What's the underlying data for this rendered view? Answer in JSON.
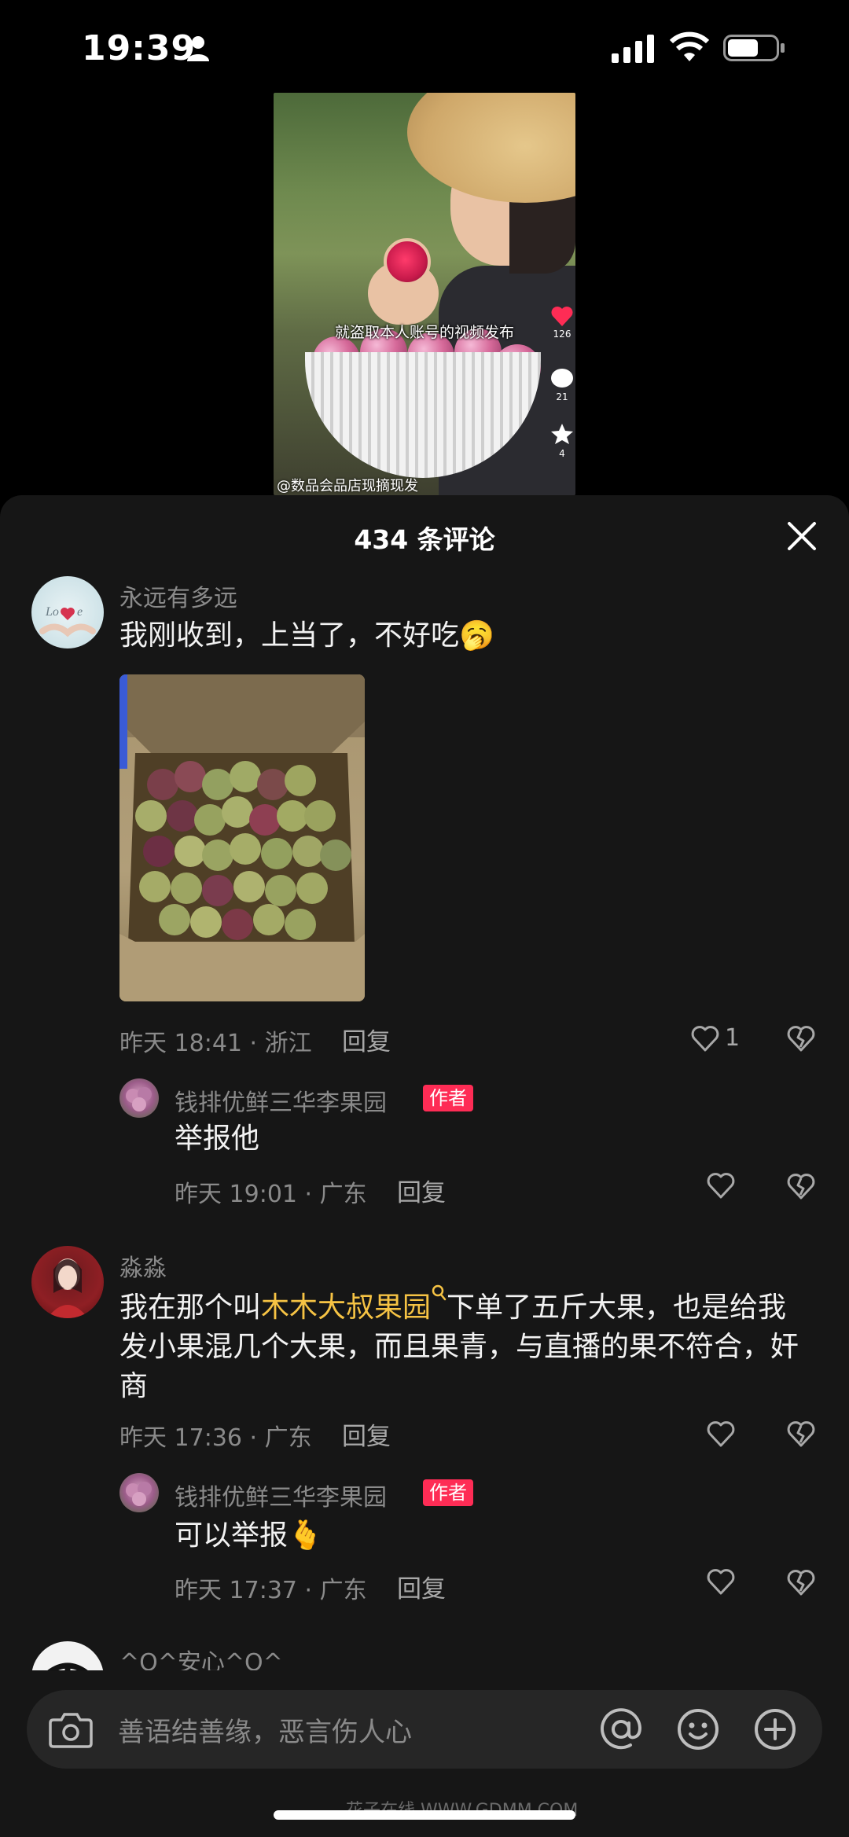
{
  "status_bar": {
    "time": "19:39"
  },
  "video": {
    "caption": "就盗取本人账号的视频发布",
    "side_counts": [
      "126",
      "21",
      "4"
    ],
    "bottom_text": "@数品会品店现摘现发"
  },
  "comments_panel": {
    "title": "434 条评论",
    "comments": [
      {
        "username": "永远有多远",
        "text": "我刚收到，上当了，不好吃🥱",
        "meta": "昨天 18:41 · 浙江",
        "reply_label": "回复",
        "like_count": "1"
      },
      {
        "username": "钱排优鲜三华李果园",
        "badge": "作者",
        "text": "举报他",
        "meta": "昨天 19:01 · 广东",
        "reply_label": "回复"
      },
      {
        "username": "淼淼",
        "text_before": "我在那个叫",
        "text_link": "木木大叔果园",
        "text_after": "下单了五斤大果，也是给我发小果混几个大果，而且果青，与直播的果不符合，奸商",
        "meta": "昨天 17:36 · 广东",
        "reply_label": "回复"
      },
      {
        "username": "钱排优鲜三华李果园",
        "badge": "作者",
        "text": "可以举报🫰",
        "meta": "昨天 17:37 · 广东",
        "reply_label": "回复"
      },
      {
        "username": "^O^安心^O^"
      }
    ]
  },
  "input_bar": {
    "placeholder": "善语结善缘，恶言伤人心"
  },
  "watermark": "花子在线 WWW.GDMM.COM",
  "colors": {
    "accent": "#fe2c55",
    "link": "#f6c344",
    "panel_bg": "#161616"
  }
}
